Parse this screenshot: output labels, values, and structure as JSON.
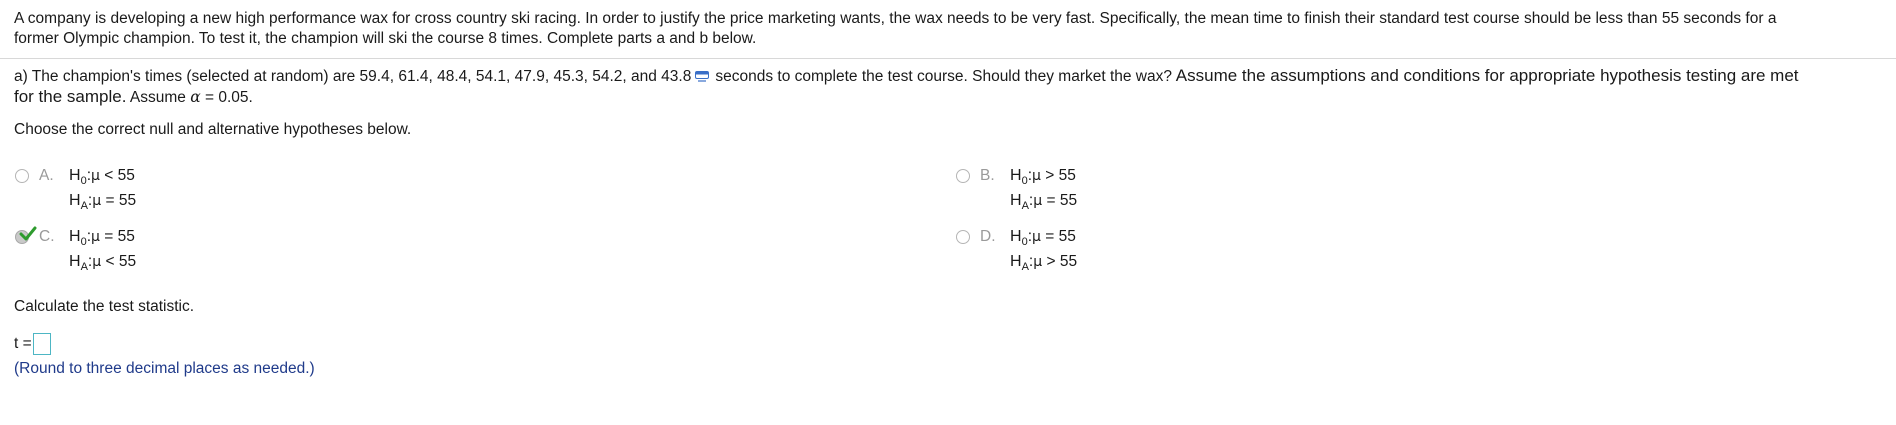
{
  "problem": {
    "intro_line1": "A company is developing a new high performance wax for cross country ski racing. In order to justify the price marketing wants, the wax needs to be very fast. Specifically, the mean time to finish their standard test course should be less than 55 seconds for a",
    "intro_line2": "former Olympic champion. To test it, the champion will ski the course 8 times. Complete parts a and b below."
  },
  "part_a": {
    "text_before_icon": "a) The champion's times (selected at random) are 59.4, 61.4, 48.4, 54.1, 47.9, 45.3, 54.2, and 43.8",
    "text_after_icon": "seconds to complete the test course. Should they market the wax?",
    "text_large": " Assume the assumptions and conditions for appropriate hypothesis testing are met",
    "line2_large": "for the sample.",
    "line2_small": " Assume ",
    "alpha_symbol": "α",
    "alpha_value": " = 0.05."
  },
  "choose_prompt": "Choose the correct null and alternative hypotheses below.",
  "options": [
    {
      "letter": "A.",
      "h0_op": "<",
      "h0_val": "55",
      "ha_op": "=",
      "ha_val": "55",
      "selected": false
    },
    {
      "letter": "B.",
      "h0_op": ">",
      "h0_val": "55",
      "ha_op": "=",
      "ha_val": "55",
      "selected": false
    },
    {
      "letter": "C.",
      "h0_op": "=",
      "h0_val": "55",
      "ha_op": "<",
      "ha_val": "55",
      "selected": true
    },
    {
      "letter": "D.",
      "h0_op": "=",
      "h0_val": "55",
      "ha_op": ">",
      "ha_val": "55",
      "selected": false
    }
  ],
  "symbols": {
    "H": "H",
    "sub0": "0",
    "subA": "A",
    "colon": ":",
    "mu": "μ"
  },
  "calc_prompt": "Calculate the test statistic.",
  "t_label": "t =",
  "t_value": "",
  "hint": "(Round to three decimal places as needed.)",
  "colors": {
    "check": "#2e9b2e",
    "box_border": "#4db6c4",
    "hint": "#1f3a8a"
  },
  "icons": {
    "data": "data-table-icon",
    "check": "checkmark-icon"
  }
}
